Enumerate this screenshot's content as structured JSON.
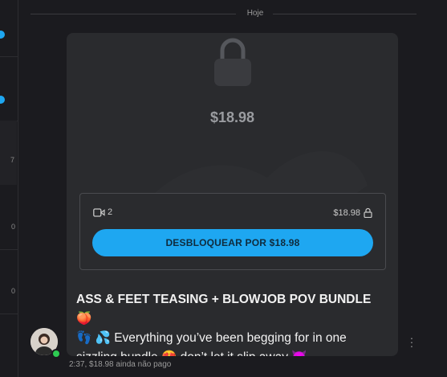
{
  "sidebar": {
    "numbers": [
      "7",
      "0",
      "0"
    ]
  },
  "divider": {
    "date_label": "Hoje"
  },
  "post": {
    "locked_price": "$18.98",
    "media_count": "2",
    "panel_price": "$18.98",
    "unlock_label": "DESBLOQUEAR POR $18.98",
    "caption_title": "ASS & FEET TEASING + BLOWJOB POV BUNDLE 🍑",
    "caption_body": "👣 💦 Everything you’ve been begging for in one sizzling bundle 😍 don’t let it slip away 😈"
  },
  "meta": {
    "time": "2:37,",
    "status": "$18.98 ainda não pago"
  },
  "colors": {
    "accent": "#1ea7f1",
    "online": "#2ecc52",
    "card_bg": "#2a2b2e",
    "page_bg": "#1b1b1f"
  },
  "icons": [
    "lock-icon",
    "video-icon",
    "small-lock-icon",
    "more-vertical-icon"
  ]
}
